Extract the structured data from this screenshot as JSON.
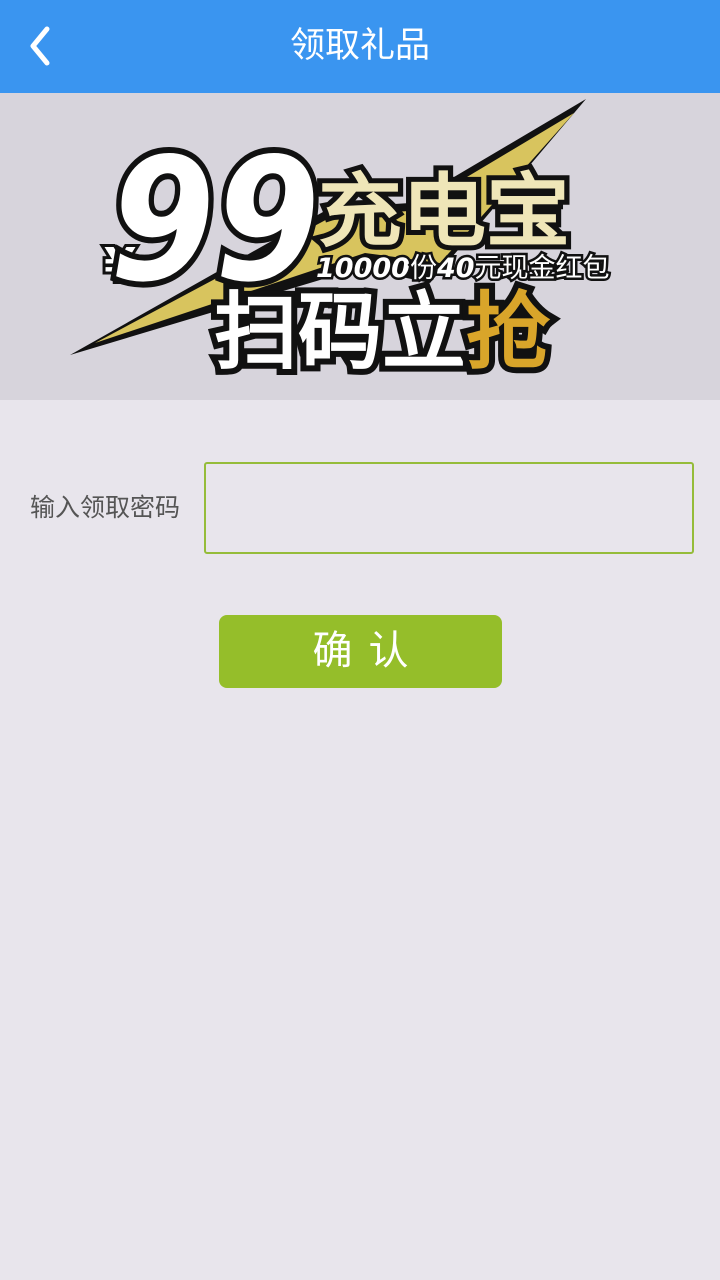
{
  "header": {
    "title": "领取礼品",
    "back_icon": "chevron-left-icon"
  },
  "banner": {
    "currency": "¥",
    "amount": "99",
    "product": "充电宝",
    "subtitle_count": "10000",
    "subtitle_unit": "份",
    "subtitle_value": "40",
    "subtitle_rest": "元现金红包",
    "cta_main": "扫码立",
    "cta_accent": "抢"
  },
  "form": {
    "label": "输入领取密码",
    "value": "",
    "placeholder": ""
  },
  "confirm": {
    "label": "确认"
  },
  "colors": {
    "header_bg": "#3a95f0",
    "page_bg": "#e8e5ec",
    "banner_bg": "#d7d4dc",
    "accent_green": "#95be2a",
    "gold": "#d8c45e"
  }
}
